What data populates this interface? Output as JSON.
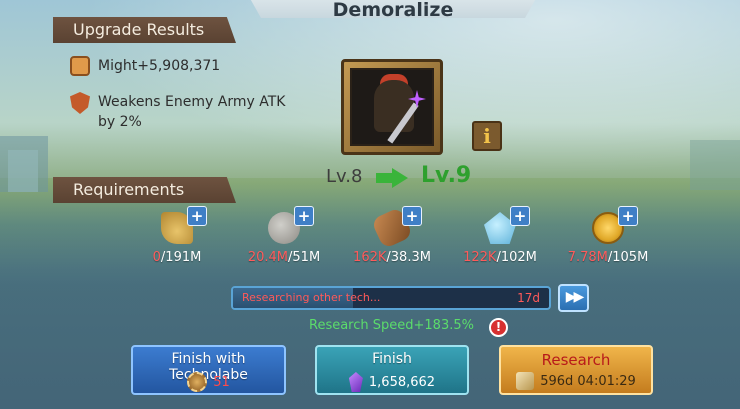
{
  "title": "Demoralize",
  "upgrade_results": {
    "heading": "Upgrade Results",
    "might": "Might+5,908,371",
    "effect": "Weakens Enemy Army ATK by 2%"
  },
  "skill": {
    "level_from": "Lv.8",
    "level_to": "Lv.9",
    "info_label": "i"
  },
  "requirements": {
    "heading": "Requirements",
    "items": [
      {
        "icon": "wheat-icon",
        "have": "0",
        "need": "/191M"
      },
      {
        "icon": "stone-icon",
        "have": "20.4M",
        "need": "/51M"
      },
      {
        "icon": "timber-icon",
        "have": "162K",
        "need": "/38.3M"
      },
      {
        "icon": "ore-icon",
        "have": "122K",
        "need": "/102M"
      },
      {
        "icon": "gold-icon",
        "have": "7.78M",
        "need": "/105M"
      }
    ],
    "plus_label": "+"
  },
  "progress": {
    "label": "Researching other tech...",
    "remaining": "17d",
    "fill_fraction": 0.38,
    "speedup_label": "▶▶"
  },
  "research_speed": "Research Speed+183.5%",
  "warning_label": "!",
  "buttons": {
    "technolabe": {
      "title": "Finish with Technolabe",
      "count": "51"
    },
    "finish": {
      "title": "Finish",
      "cost": "1,658,662"
    },
    "research": {
      "title": "Research",
      "time": "596d 04:01:29"
    }
  },
  "colors": {
    "insufficient": "#ff5b5b",
    "level_up": "#2ea02e",
    "speed": "#5bdc6b"
  }
}
